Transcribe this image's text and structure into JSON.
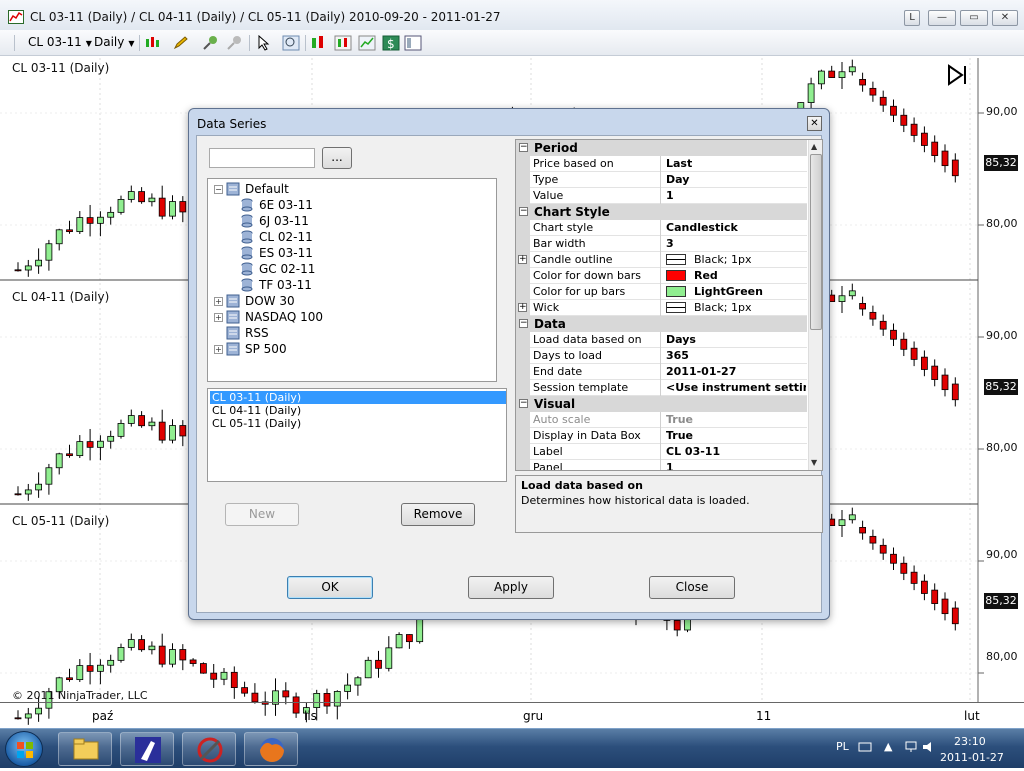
{
  "window": {
    "title": "CL 03-11 (Daily) / CL 04-11 (Daily) / CL 05-11 (Daily)  2010-09-20 - 2011-01-27",
    "buttons": {
      "link": "L",
      "minimize": "—",
      "maximize": "▭",
      "close": "✕"
    }
  },
  "toolbar": {
    "instrument": "CL 03-11",
    "period": "Daily",
    "icons": [
      "bar-style-icon",
      "pencil-icon",
      "zoom-in-icon",
      "crosshair-icon",
      "pointer-icon",
      "magnifier-icon",
      "data-series-icon",
      "strategy-icon",
      "chart-icon",
      "dollar-icon",
      "properties-icon"
    ]
  },
  "panels": [
    {
      "label": "CL 03-11 (Daily)",
      "ticks": [
        "90,00",
        "80,00"
      ],
      "last_price": "85,32"
    },
    {
      "label": "CL 04-11 (Daily)",
      "ticks": [
        "90,00",
        "80,00"
      ],
      "last_price": "85,32"
    },
    {
      "label": "CL 05-11 (Daily)",
      "ticks": [
        "90,00",
        "80,00"
      ],
      "last_price": "85,32"
    }
  ],
  "x_axis": {
    "labels": [
      "paź",
      "lis",
      "gru",
      "11",
      "lut"
    ]
  },
  "copyright": "© 2011 NinjaTrader, LLC",
  "colors": {
    "up": "#90ee90",
    "down": "#e00000",
    "dialog_frame": "#c8d7ec",
    "selection": "#3399ff"
  },
  "dialog": {
    "title": "Data Series",
    "close_label": "✕",
    "search": {
      "value": "",
      "button_label": "..."
    },
    "tree": [
      {
        "label": "Default",
        "expanded": true,
        "level": 0,
        "children": [
          "6E 03-11",
          "6J 03-11",
          "CL 02-11",
          "ES 03-11",
          "GC 02-11",
          "TF 03-11"
        ]
      },
      {
        "label": "DOW 30",
        "expanded": false,
        "level": 0
      },
      {
        "label": "NASDAQ 100",
        "expanded": false,
        "level": 0
      },
      {
        "label": "RSS",
        "expanded": false,
        "level": 0
      },
      {
        "label": "SP 500",
        "expanded": false,
        "level": 0
      }
    ],
    "series": [
      "CL 03-11 (Daily)",
      "CL 04-11 (Daily)",
      "CL 05-11 (Daily)"
    ],
    "selected_series": 0,
    "buttons": {
      "new": "New",
      "remove": "Remove",
      "ok": "OK",
      "apply": "Apply",
      "close": "Close"
    },
    "properties": [
      {
        "category": "Period",
        "rows": [
          {
            "name": "Price based on",
            "value": "Last"
          },
          {
            "name": "Type",
            "value": "Day"
          },
          {
            "name": "Value",
            "value": "1"
          }
        ]
      },
      {
        "category": "Chart Style",
        "rows": [
          {
            "name": "Chart style",
            "value": "Candlestick"
          },
          {
            "name": "Bar width",
            "value": "3"
          },
          {
            "name": "Candle outline",
            "value": "Black; 1px",
            "swatch": "#ffffff",
            "line": true,
            "expandable": true
          },
          {
            "name": "Color for down bars",
            "value": "Red",
            "swatch": "#ff0000"
          },
          {
            "name": "Color for up bars",
            "value": "LightGreen",
            "swatch": "#90ee90"
          },
          {
            "name": "Wick",
            "value": "Black; 1px",
            "swatch": "#ffffff",
            "line": true,
            "expandable": true
          }
        ]
      },
      {
        "category": "Data",
        "rows": [
          {
            "name": "Load data based on",
            "value": "Days"
          },
          {
            "name": "Days to load",
            "value": "365"
          },
          {
            "name": "End date",
            "value": "2011-01-27"
          },
          {
            "name": "Session template",
            "value": "<Use instrument settings>"
          }
        ]
      },
      {
        "category": "Visual",
        "rows": [
          {
            "name": "Auto scale",
            "value": "True",
            "disabled": true
          },
          {
            "name": "Display in Data Box",
            "value": "True"
          },
          {
            "name": "Label",
            "value": "CL 03-11"
          },
          {
            "name": "Panel",
            "value": "1"
          }
        ]
      }
    ],
    "description": {
      "title": "Load data based on",
      "text": "Determines how historical data is loaded."
    }
  },
  "taskbar": {
    "apps": [
      "explorer-icon",
      "ninjatrader-icon",
      "ninja-logo-icon",
      "firefox-icon"
    ],
    "language": "PL",
    "time": "23:10",
    "date": "2011-01-27"
  }
}
